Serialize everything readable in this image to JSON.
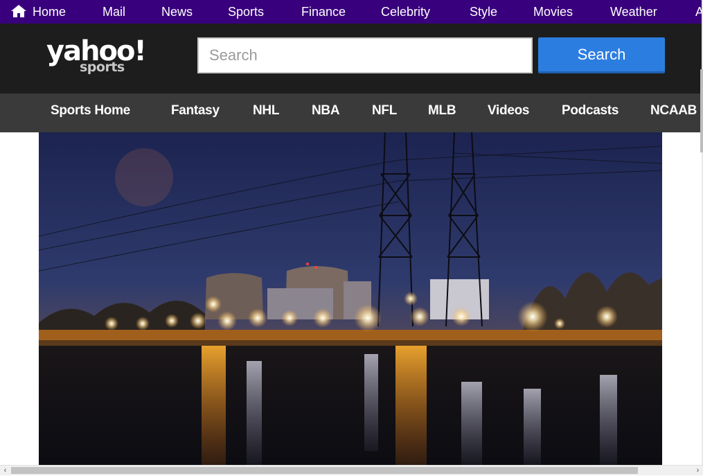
{
  "top_nav": {
    "home_label": "Home",
    "items": [
      {
        "label": "Mail"
      },
      {
        "label": "News"
      },
      {
        "label": "Sports"
      },
      {
        "label": "Finance"
      },
      {
        "label": "Celebrity"
      },
      {
        "label": "Style"
      },
      {
        "label": "Movies"
      },
      {
        "label": "Weather"
      },
      {
        "label": "A"
      }
    ]
  },
  "header": {
    "logo_main": "yahoo!",
    "logo_sub": "sports",
    "search_placeholder": "Search",
    "search_button": "Search"
  },
  "sports_nav": {
    "items": [
      {
        "label": "Sports Home"
      },
      {
        "label": "Fantasy"
      },
      {
        "label": "NHL"
      },
      {
        "label": "NBA"
      },
      {
        "label": "NFL"
      },
      {
        "label": "MLB"
      },
      {
        "label": "Videos"
      },
      {
        "label": "Podcasts"
      },
      {
        "label": "NCAAB"
      }
    ]
  },
  "colors": {
    "top_nav_bg": "#39007d",
    "header_bg": "#1d1d1d",
    "sports_nav_bg": "#3a3a3a",
    "search_button_bg": "#2c7de0"
  },
  "scrollbar": {
    "left_arrow": "‹",
    "right_arrow": "›"
  },
  "hero_image": {
    "icon": "photo-nuclear-plant-at-night"
  }
}
